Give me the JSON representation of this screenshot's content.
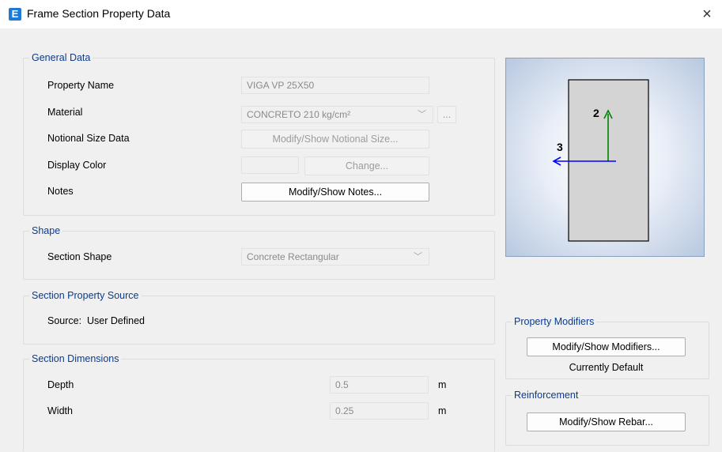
{
  "window": {
    "app_icon": "E",
    "title": "Frame Section Property Data",
    "close_glyph": "×"
  },
  "general": {
    "legend": "General Data",
    "property_name_label": "Property Name",
    "property_name_value": "VIGA VP 25X50",
    "material_label": "Material",
    "material_value": "CONCRETO 210 kg/cm²",
    "material_more": "...",
    "notional_label": "Notional Size Data",
    "notional_button": "Modify/Show Notional Size...",
    "display_color_label": "Display Color",
    "change_button": "Change...",
    "notes_label": "Notes",
    "notes_button": "Modify/Show Notes..."
  },
  "shape": {
    "legend": "Shape",
    "section_shape_label": "Section Shape",
    "section_shape_value": "Concrete Rectangular"
  },
  "source": {
    "legend": "Section Property Source",
    "source_text": "Source:  User Defined"
  },
  "dimensions": {
    "legend": "Section Dimensions",
    "depth_label": "Depth",
    "depth_value": "0.5",
    "depth_unit": "m",
    "width_label": "Width",
    "width_value": "0.25",
    "width_unit": "m"
  },
  "preview": {
    "axis2_label": "2",
    "axis3_label": "3",
    "axis2_color": "#008000",
    "axis3_color": "#0000ff"
  },
  "modifiers": {
    "legend": "Property Modifiers",
    "button": "Modify/Show Modifiers...",
    "status": "Currently Default"
  },
  "reinforcement": {
    "legend": "Reinforcement",
    "button": "Modify/Show Rebar..."
  }
}
